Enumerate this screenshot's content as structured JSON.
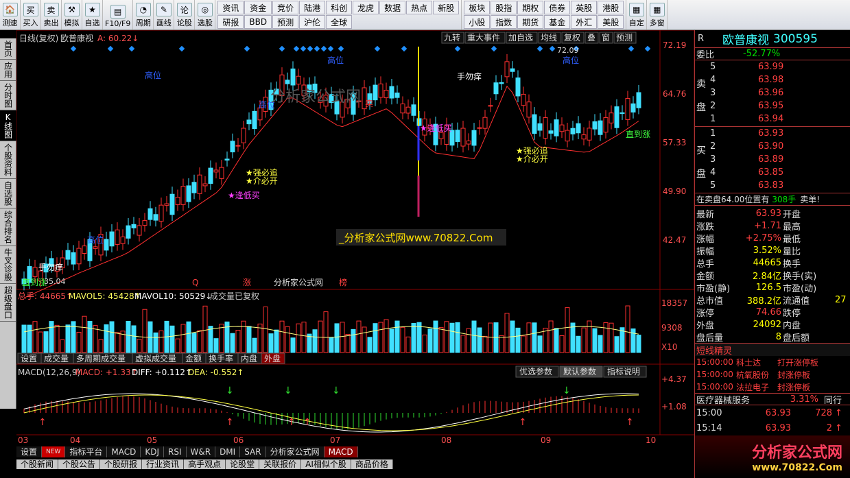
{
  "toolbar": {
    "left": [
      {
        "icon": "🏠",
        "label": "测速"
      },
      {
        "icon": "买",
        "label": "买入"
      },
      {
        "icon": "卖",
        "label": "卖出"
      },
      {
        "icon": "⚒",
        "label": "模拟"
      },
      {
        "icon": "★",
        "label": "自选"
      },
      {
        "icon": "▤",
        "label": "F10/F9"
      },
      {
        "icon": "◔",
        "label": "周期"
      },
      {
        "icon": "✎",
        "label": "画线"
      },
      {
        "icon": "论",
        "label": "论股"
      },
      {
        "icon": "◎",
        "label": "选股"
      }
    ],
    "mid": [
      "资讯",
      "资金",
      "竞价",
      "陆港",
      "科创",
      "龙虎",
      "数据",
      "热点",
      "新股",
      "研报",
      "BBD",
      "预测",
      "沪伦",
      "全球"
    ],
    "right": [
      "板块",
      "股指",
      "期权",
      "债券",
      "英股",
      "港股",
      "小股",
      "指数",
      "期货",
      "基金",
      "外汇",
      "美股"
    ],
    "far": [
      {
        "label": "自定"
      },
      {
        "label": "多窗"
      }
    ]
  },
  "left_tabs": [
    "首页",
    "应用",
    "分时图",
    "K线图",
    "个股资料",
    "自选股",
    "综合排名",
    "牛叉诊股",
    "超级盘口"
  ],
  "chart": {
    "header": {
      "title": "日线(复权)",
      "name": "欧普康视",
      "price_label": "A: 60.22↓"
    },
    "topbuttons": [
      "九转",
      "重大事件",
      "加自选",
      "均线",
      "复权",
      "叠",
      "窗",
      "预测"
    ],
    "price_axis": [
      "72.19",
      "64.76",
      "57.33",
      "49.90",
      "42.47"
    ],
    "max_label": "72.09",
    "min_label": "35.04",
    "signals": {
      "high": "高位",
      "sell": "卖",
      "buy_low": "逢低买",
      "strong": "强必追",
      "weak": "介必开",
      "bottom": "直到涨",
      "no_rush": "手勿痒"
    },
    "watermark": "分析家公式网",
    "center_link": "_分析家公式网www.70822.Com",
    "vol_header": {
      "total": "总手: 44665↑",
      "ma5": "MAVOL5: 45428↑",
      "ma10": "MAVOL10: 50529↓",
      "note": "成交量已复权"
    },
    "vol_axis": [
      "18357",
      "9308",
      "X10"
    ],
    "vol_tabs": [
      "设置",
      "成交量",
      "多周期成交量",
      "虚拟成交量",
      "金额",
      "换手率",
      "内盘",
      "外盘"
    ],
    "macd_header": {
      "name": "MACD(12,26,9)",
      "macd": "MACD: +1.33↑",
      "diff": "DIFF: +0.112↑",
      "dea": "DEA: -0.552↑"
    },
    "macd_buttons": [
      "优选参数",
      "默认参数",
      "指标说明"
    ],
    "macd_axis": [
      "+4.37",
      "+1.08"
    ],
    "months": [
      "03",
      "04",
      "05",
      "06",
      "07",
      "08",
      "09",
      "10"
    ],
    "markers": [
      "Q",
      "涨",
      "分析家公式网",
      "榜"
    ]
  },
  "bottom_tabs": [
    "设置",
    "NEW",
    "指标平台",
    "MACD",
    "KDJ",
    "RSI",
    "W&R",
    "DMI",
    "SAR",
    "分析家公式网",
    "MACD"
  ],
  "last_tabs": [
    "个股新闻",
    "个股公告",
    "个股研报",
    "行业资讯",
    "高手观点",
    "论股堂",
    "关联报价",
    "AI相似个股",
    "商品价格"
  ],
  "quote": {
    "code": "300595",
    "name": "欧普康视",
    "r": "R",
    "weibi_label": "委比",
    "weibi": "-52.77%",
    "sell": [
      {
        "n": "5",
        "p": "63.99"
      },
      {
        "n": "4",
        "p": "63.98"
      },
      {
        "n": "3",
        "p": "63.96"
      },
      {
        "n": "2",
        "p": "63.95"
      },
      {
        "n": "1",
        "p": "63.94"
      }
    ],
    "buy": [
      {
        "n": "1",
        "p": "63.93"
      },
      {
        "n": "2",
        "p": "63.90"
      },
      {
        "n": "3",
        "p": "63.89"
      },
      {
        "n": "4",
        "p": "63.85"
      },
      {
        "n": "5",
        "p": "63.83"
      }
    ],
    "sell_label": "卖盘",
    "buy_label": "买盘",
    "notice": "在卖盘64.00位置有",
    "notice_vol": "308手",
    "notice_tail": "卖单!",
    "stats": [
      [
        "最新",
        "63.93",
        "开盘",
        ""
      ],
      [
        "涨跌",
        "+1.71",
        "最高",
        ""
      ],
      [
        "涨幅",
        "+2.75%",
        "最低",
        ""
      ],
      [
        "振幅",
        "3.52%",
        "量比",
        ""
      ],
      [
        "总手",
        "44665",
        "换手",
        ""
      ],
      [
        "金额",
        "2.84亿",
        "换手(实)",
        ""
      ],
      [
        "市盈(静)",
        "126.5",
        "市盈(动)",
        ""
      ],
      [
        "总市值",
        "388.2亿",
        "流通值",
        "27"
      ],
      [
        "涨停",
        "74.66",
        "跌停",
        ""
      ],
      [
        "外盘",
        "24092",
        "内盘",
        ""
      ],
      [
        "盘后量",
        "8",
        "盘后额",
        ""
      ]
    ],
    "sprite_title": "短线精灵",
    "sprites": [
      [
        "15:00:00",
        "科士达",
        "打开涨停板"
      ],
      [
        "15:00:00",
        "杭氧股份",
        "封涨停板"
      ],
      [
        "15:00:00",
        "法拉电子",
        "封涨停板"
      ]
    ],
    "sector": "医疗器械服务",
    "sector_pct": "3.31%",
    "sector_tab": "同行",
    "ticks": [
      [
        "15:00",
        "63.93",
        "728"
      ],
      [
        "15:14",
        "63.93",
        "2"
      ]
    ],
    "logo": "分析家公式网",
    "logo_url": "www.70822.Com"
  }
}
